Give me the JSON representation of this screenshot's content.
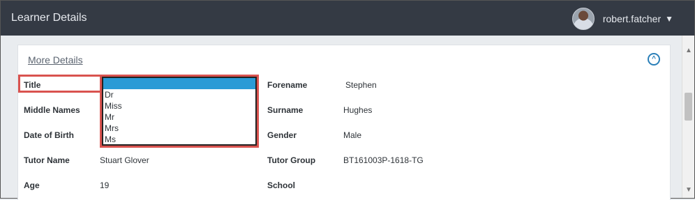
{
  "header": {
    "title": "Learner Details",
    "username": "robert.fatcher",
    "caret": "▼"
  },
  "panel": {
    "heading": "More Details",
    "collapse_icon": "chevron-up-circle"
  },
  "fields": {
    "title_label": "Title",
    "forename_label": "Forename",
    "forename_value": "Stephen",
    "middle_names_label": "Middle Names",
    "surname_label": "Surname",
    "surname_value": "Hughes",
    "dob_label": "Date of Birth",
    "gender_label": "Gender",
    "gender_value": "Male",
    "tutor_name_label": "Tutor Name",
    "tutor_name_value": "Stuart Glover",
    "tutor_group_label": "Tutor Group",
    "tutor_group_value": "BT161003P-1618-TG",
    "age_label": "Age",
    "age_value": "19",
    "school_label": "School"
  },
  "title_dropdown": {
    "options": [
      "",
      "Dr",
      "Miss",
      "Mr",
      "Mrs",
      "Ms"
    ],
    "selected_index": 0
  },
  "colors": {
    "header_bg": "#343a44",
    "highlight": "#d9534f",
    "selected_option": "#2a9bd6",
    "accent": "#2a7fb8"
  }
}
